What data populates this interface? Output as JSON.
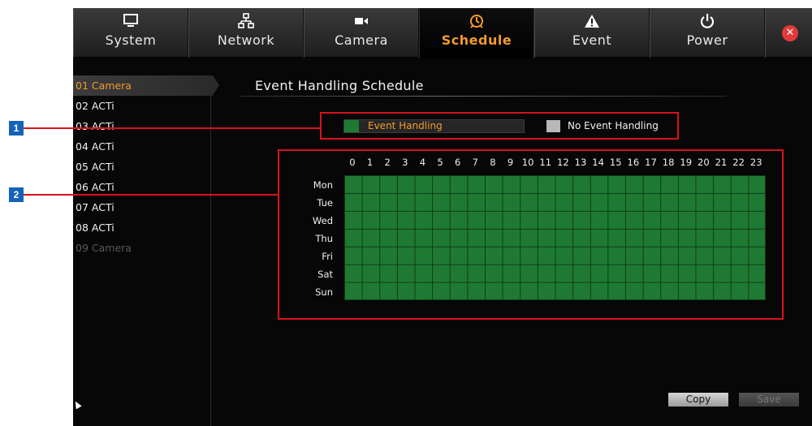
{
  "tabs": [
    {
      "label": "System",
      "icon": "monitor-icon",
      "active": false
    },
    {
      "label": "Network",
      "icon": "network-icon",
      "active": false
    },
    {
      "label": "Camera",
      "icon": "camera-icon",
      "active": false
    },
    {
      "label": "Schedule",
      "icon": "schedule-icon",
      "active": true
    },
    {
      "label": "Event",
      "icon": "warning-icon",
      "active": false
    },
    {
      "label": "Power",
      "icon": "power-icon",
      "active": false
    }
  ],
  "close_icon": "close-icon",
  "cameras": [
    {
      "label": "01 Camera",
      "state": "active"
    },
    {
      "label": "02 ACTi",
      "state": "normal"
    },
    {
      "label": "03 ACTi",
      "state": "normal"
    },
    {
      "label": "04 ACTi",
      "state": "normal"
    },
    {
      "label": "05 ACTi",
      "state": "normal"
    },
    {
      "label": "06 ACTi",
      "state": "normal"
    },
    {
      "label": "07 ACTi",
      "state": "normal"
    },
    {
      "label": "08 ACTi",
      "state": "normal"
    },
    {
      "label": "09 Camera",
      "state": "disabled"
    }
  ],
  "section_title": "Event Handling Schedule",
  "legend": {
    "event_handling": "Event Handling",
    "no_event_handling": "No Event Handling",
    "event_color": "#1e7a32",
    "no_event_color": "#b8b8b8"
  },
  "hours": [
    "0",
    "1",
    "2",
    "3",
    "4",
    "5",
    "6",
    "7",
    "8",
    "9",
    "10",
    "11",
    "12",
    "13",
    "14",
    "15",
    "16",
    "17",
    "18",
    "19",
    "20",
    "21",
    "22",
    "23"
  ],
  "days": [
    "Mon",
    "Tue",
    "Wed",
    "Thu",
    "Fri",
    "Sat",
    "Sun"
  ],
  "buttons": {
    "copy": "Copy",
    "save": "Save"
  },
  "callouts": [
    "1",
    "2"
  ],
  "colors": {
    "accent": "#f29a2e",
    "highlight_box": "#d8111c",
    "callout_bg": "#1463b8"
  }
}
